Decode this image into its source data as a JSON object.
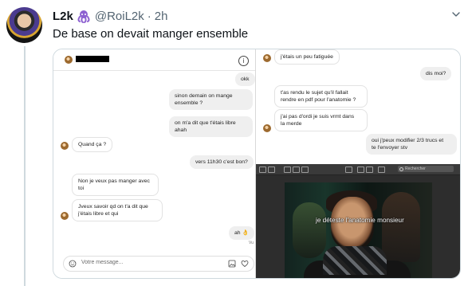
{
  "tweet": {
    "name": "L2k",
    "handle": "@RoiL2k",
    "separator": "·",
    "time": "2h",
    "text": "De base on devait manger ensemble"
  },
  "conversation_left": {
    "messages": [
      {
        "text": "okk"
      },
      {
        "text": "sinon demain on mange\nensemble ?"
      },
      {
        "text": "on m'a dit que t'étais libre ahah"
      },
      {
        "text": "Quand ça ?"
      },
      {
        "text": "vers 11h30 c'est bon?"
      },
      {
        "text": "Non je veux pas manger avec\ntoi"
      },
      {
        "text": "Jveux savoir qd on t'a dit que\nj'étais libre et qui"
      },
      {
        "text": "ah 👌"
      }
    ],
    "seen_label": "Vu",
    "composer_placeholder": "Votre message..."
  },
  "conversation_right": {
    "messages": [
      {
        "text": "j'étais un peu fatiguée"
      },
      {
        "text": "dis moi?"
      },
      {
        "text": "t'as rendu le sujet qu'il fallait\nrendre en pdf pour l'anatomie ?"
      },
      {
        "text": "j'ai pas d'ordi je suis vrmt dans\nla merde"
      },
      {
        "text": "oui j'peux modifier 2/3 trucs et\nte l'envoyer stv"
      }
    ],
    "search_placeholder": "Rechercher",
    "meme_caption": "je déteste l'anatomie monsieur"
  }
}
